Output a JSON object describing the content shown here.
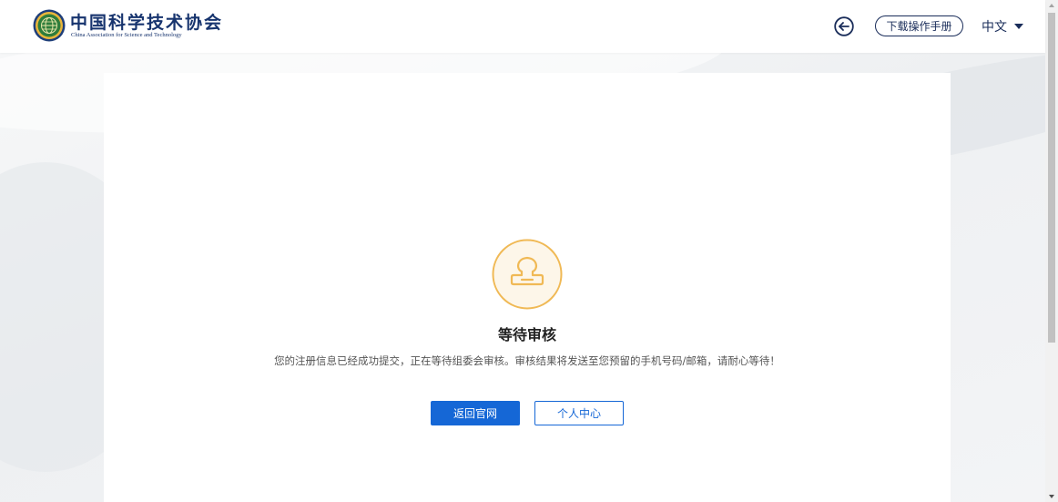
{
  "header": {
    "logo_cn": "中国科学技术协会",
    "logo_en": "China Association for Science and Technology",
    "back_icon": "back-arrow-icon",
    "manual_label": "下载操作手册",
    "language": "中文"
  },
  "main": {
    "title": "等待审核",
    "message": "您的注册信息已经成功提交，正在等待组委会审核。审核结果将发送至您预留的手机号码/邮箱，请耐心等待！",
    "icon": "stamp-icon",
    "primary_button": "返回官网",
    "secondary_button": "个人中心"
  },
  "colors": {
    "brand_navy": "#1a2d5a",
    "primary_blue": "#1567d6",
    "icon_gold": "#f0b955",
    "icon_bg": "#fdf6e9"
  }
}
